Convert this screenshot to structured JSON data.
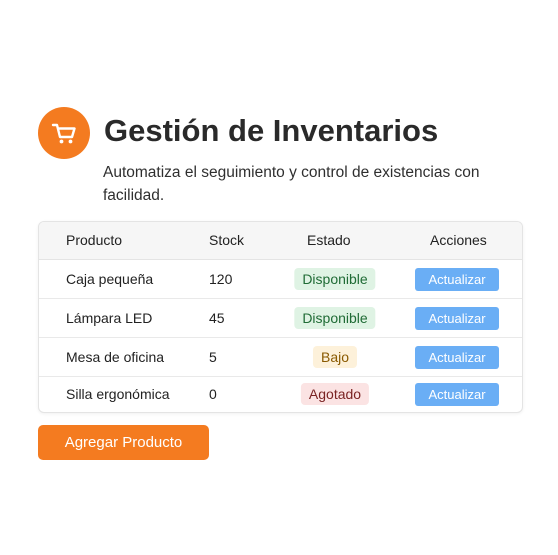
{
  "header": {
    "logo_icon": "shopping-cart-icon",
    "title": "Gestión de Inventarios",
    "subtitle": "Automatiza el seguimiento y control de existencias con facilidad."
  },
  "table": {
    "columns": [
      "Producto",
      "Stock",
      "Estado",
      "Acciones"
    ],
    "rows": [
      {
        "product": "Caja pequeña",
        "stock": "120",
        "status": "Disponible",
        "status_type": "available",
        "action": "Actualizar"
      },
      {
        "product": "Lámpara LED",
        "stock": "45",
        "status": "Disponible",
        "status_type": "available",
        "action": "Actualizar"
      },
      {
        "product": "Mesa de oficina",
        "stock": "5",
        "status": "Bajo",
        "status_type": "low",
        "action": "Actualizar"
      },
      {
        "product": "Silla ergonómica",
        "stock": "0",
        "status": "Agotado",
        "status_type": "out",
        "action": "Actualizar"
      }
    ]
  },
  "actions": {
    "add_label": "Agregar Producto"
  },
  "colors": {
    "accent": "#f47b20",
    "button_blue": "#6aaef5",
    "available_bg": "#dff3e4",
    "low_bg": "#fdf1da",
    "out_bg": "#fbe3e3"
  }
}
